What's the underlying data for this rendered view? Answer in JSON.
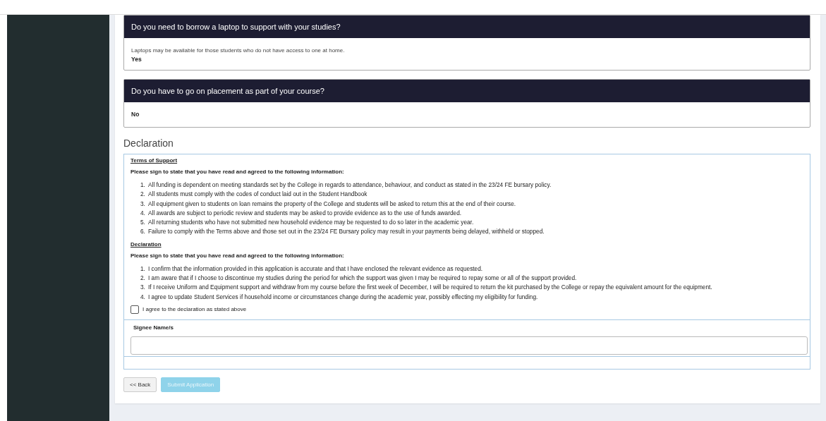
{
  "questions": [
    {
      "title": "Do you need to borrow a laptop to support with your studies?",
      "hint": "Laptops may be available for those students who do not have access to one at home.",
      "answer": "Yes"
    },
    {
      "title": "Do you have to go on placement as part of your course?",
      "answer": "No"
    }
  ],
  "declaration": {
    "heading": "Declaration",
    "sections": [
      {
        "title": "Terms of Support",
        "intro": "Please sign to state that you have read and agreed to the following information:",
        "items": [
          {
            "number": "1.",
            "text": "All funding is dependent on meeting standards set by the College in regards to attendance, behaviour, and conduct as stated in the 23/24 FE bursary policy."
          },
          {
            "number": "2.",
            "text": "All students must comply with the codes of conduct laid out in the Student Handbook"
          },
          {
            "number": "3.",
            "text": "All equipment given to students on loan remains the property of the College and students will be asked to return this at the end of their course."
          },
          {
            "number": "4.",
            "text": "All awards are subject to periodic review and students may be asked to provide evidence as to the use of funds awarded."
          },
          {
            "number": "5.",
            "text": "All returning students who have not submitted new household evidence may be requested to do so later in the academic year."
          },
          {
            "number": "6.",
            "text": "Failure to comply with the Terms above and those set out in the 23/24 FE Bursary policy may result in your payments being delayed, withheld or stopped."
          }
        ]
      },
      {
        "title": "Declaration",
        "intro": "Please sign to state that you have read and agreed to the following information:",
        "items": [
          {
            "number": "1.",
            "text": "I confirm that the information provided in this application is accurate and that I have enclosed the relevant evidence as requested."
          },
          {
            "number": "2.",
            "text": "I am aware that if I choose to discontinue my studies during the period for which the support was given I may be required to repay some or all of the support provided."
          },
          {
            "number": "3.",
            "text": "If I receive Uniform and Equipment support and withdraw from my course before the first week of December, I will be required to return the kit purchased by the College or repay the equivalent amount for the equipment."
          },
          {
            "number": "4.",
            "text": "I agree to update Student Services if household income or circumstances change during the academic year, possibly effecting my eligibility for funding."
          }
        ]
      }
    ],
    "agree": {
      "label": "I agree to the declaration as stated above",
      "checked": false
    },
    "signee": {
      "label": "Signee Name/s"
    }
  },
  "buttons": [
    {
      "label": "<< Back",
      "kind": "back",
      "disabled": false
    },
    {
      "label": "Submit Application",
      "kind": "submit",
      "disabled": true
    }
  ]
}
